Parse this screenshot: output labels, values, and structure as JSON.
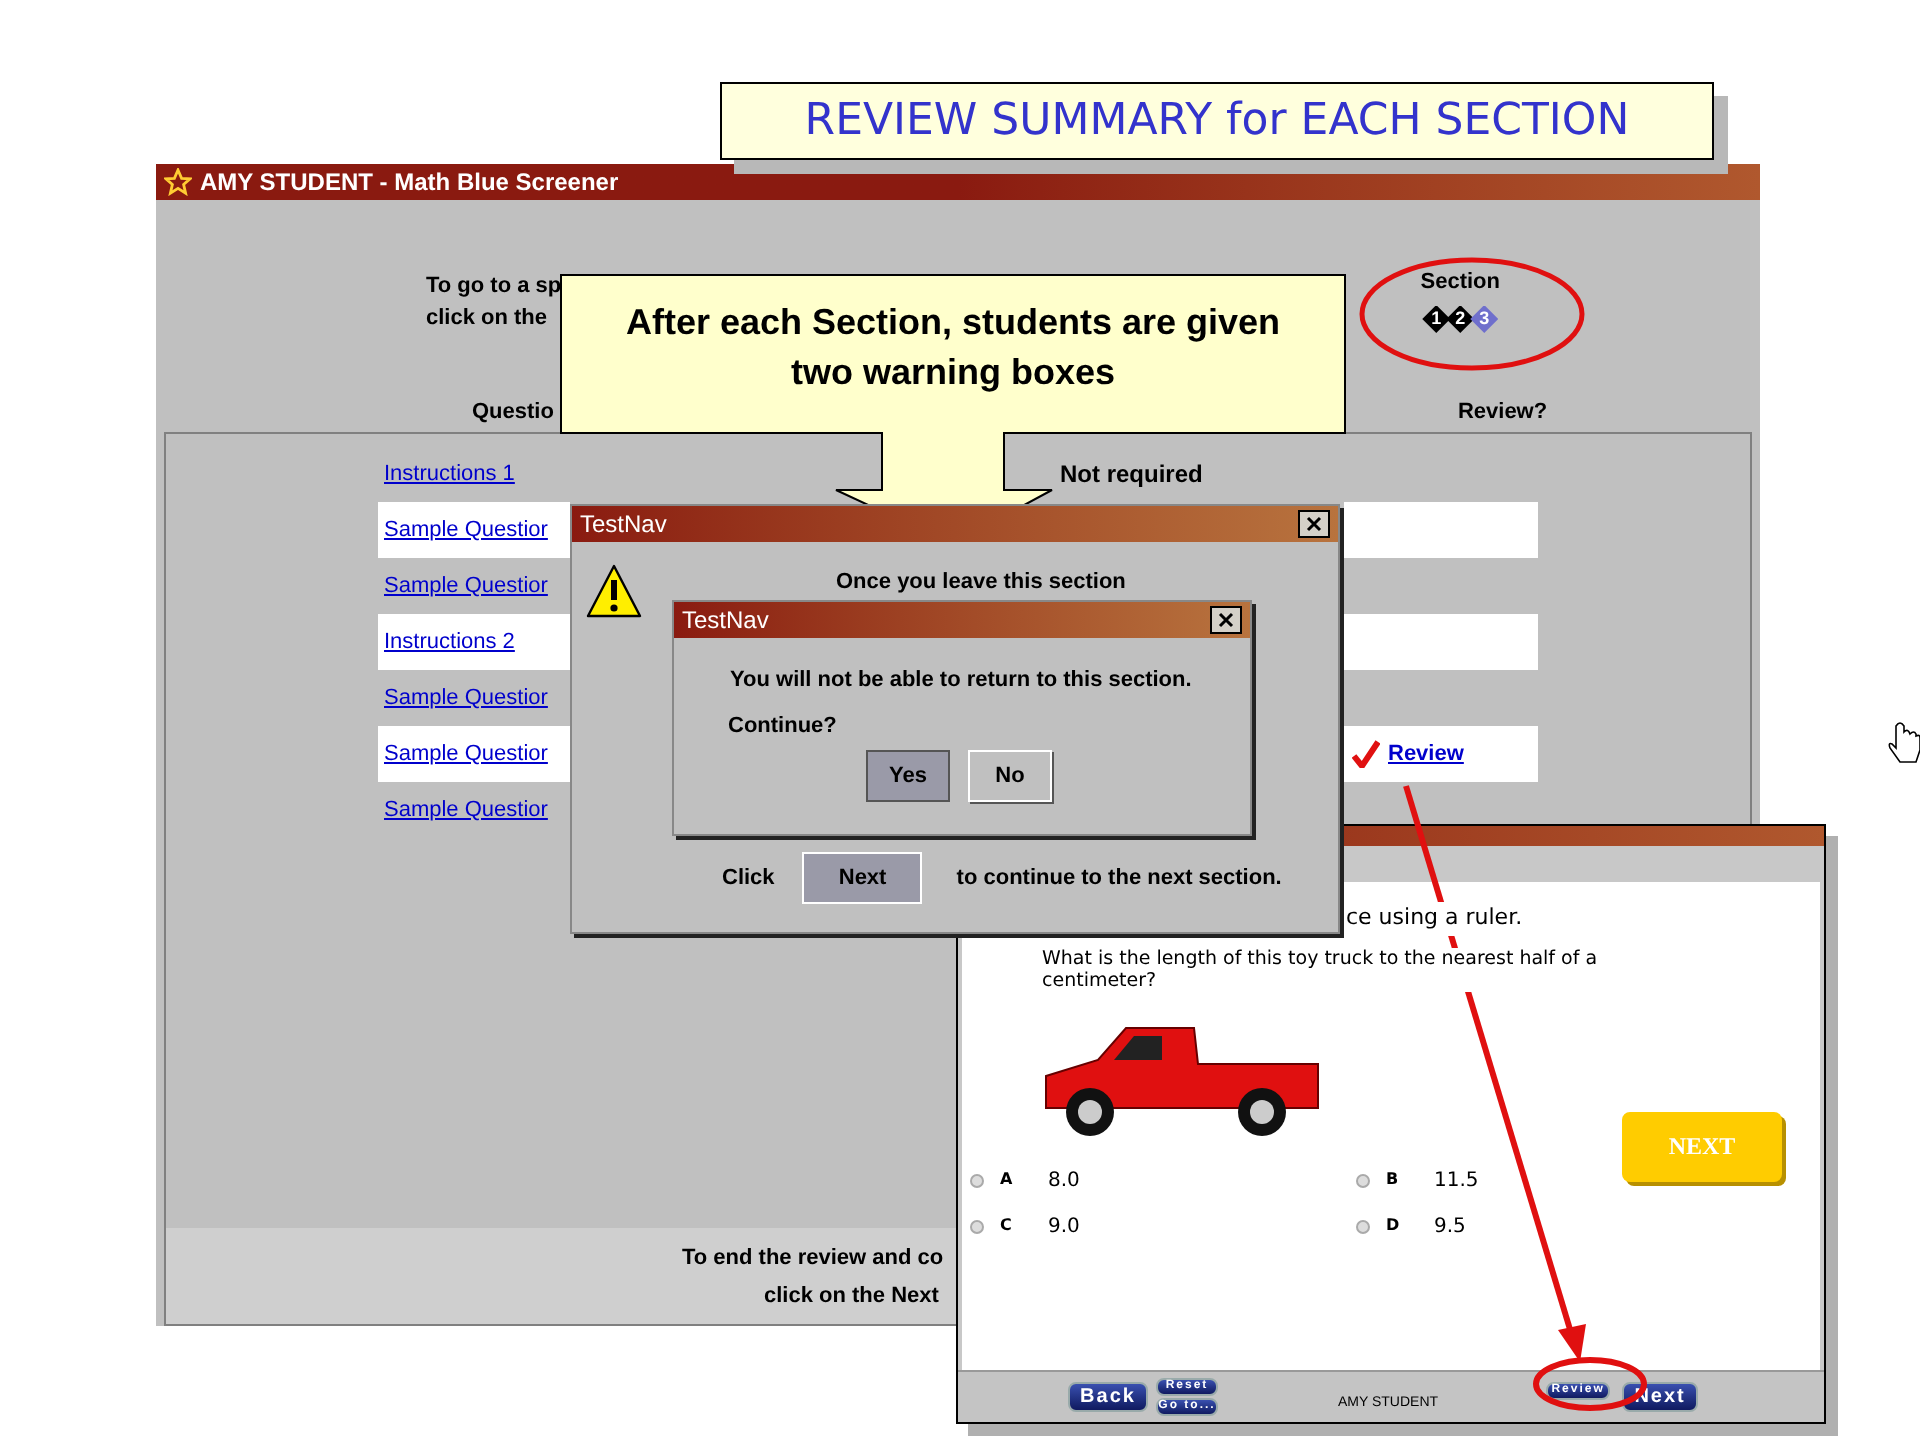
{
  "slide_title": "REVIEW SUMMARY for EACH SECTION",
  "review_window": {
    "title": "AMY  STUDENT - Math Blue Screener",
    "instructions": [
      "To go to a sp",
      "click on the"
    ],
    "section": {
      "label": "Section",
      "steps": [
        {
          "label": "1",
          "selected": false
        },
        {
          "label": "2",
          "selected": false
        },
        {
          "label": "3",
          "selected": true
        }
      ]
    },
    "column_1": "Questio",
    "column_2": "Review?",
    "rows": [
      {
        "link": "Instructions 1",
        "highlighted": false,
        "status": "Not required"
      },
      {
        "link": "Sample Questior",
        "highlighted": true
      },
      {
        "link": "Sample Questior",
        "highlighted": false
      },
      {
        "link": "Instructions 2",
        "highlighted": true
      },
      {
        "link": "Sample Questior",
        "highlighted": false
      },
      {
        "link": "Sample Questior",
        "highlighted": true,
        "review": "Review",
        "flagged": true
      },
      {
        "link": "Sample Questior",
        "highlighted": false
      }
    ],
    "footer": [
      "To end the review and co",
      "click on the Next"
    ]
  },
  "callout": "After each Section, students are given two warning boxes",
  "dialog_1": {
    "title": "TestNav",
    "message": "Once you leave this section",
    "prefix": "Click",
    "button": "Next",
    "suffix": "to continue to the next section."
  },
  "dialog_2": {
    "title": "TestNav",
    "message": "You will not be able to return to this section.",
    "question": "Continue?",
    "buttons": [
      {
        "label": "Yes",
        "selected": true
      },
      {
        "label": "No",
        "selected": false
      }
    ]
  },
  "question_window": {
    "prompt": "ce using a ruler.",
    "question": "What is the length of this toy truck to the nearest half of a centimeter?",
    "choices": [
      {
        "letter": "A",
        "value": "8.0",
        "selected": false
      },
      {
        "letter": "B",
        "value": "11.5",
        "selected": false
      },
      {
        "letter": "C",
        "value": "9.0",
        "selected": false
      },
      {
        "letter": "D",
        "value": "9.5",
        "selected": false
      }
    ],
    "next_button": "NEXT",
    "toolbar": {
      "back": "Back",
      "reset": "Reset",
      "goto": "Go to...",
      "student": "AMY  STUDENT",
      "review": "Review",
      "next": "Next"
    }
  }
}
